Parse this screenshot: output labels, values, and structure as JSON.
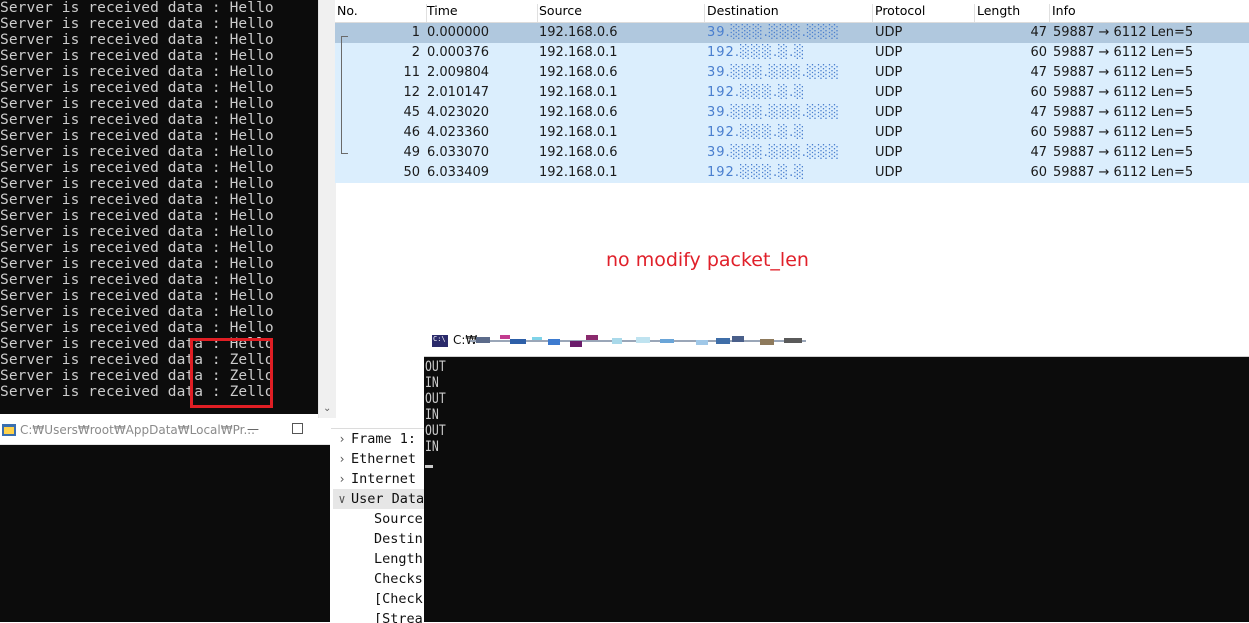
{
  "console_top": {
    "lines": [
      {
        "prefix": "Server is received data : ",
        "payload": "Hello"
      },
      {
        "prefix": "Server is received data : ",
        "payload": "Hello"
      },
      {
        "prefix": "Server is received data : ",
        "payload": "Hello"
      },
      {
        "prefix": "Server is received data : ",
        "payload": "Hello"
      },
      {
        "prefix": "Server is received data : ",
        "payload": "Hello"
      },
      {
        "prefix": "Server is received data : ",
        "payload": "Hello"
      },
      {
        "prefix": "Server is received data : ",
        "payload": "Hello"
      },
      {
        "prefix": "Server is received data : ",
        "payload": "Hello"
      },
      {
        "prefix": "Server is received data : ",
        "payload": "Hello"
      },
      {
        "prefix": "Server is received data : ",
        "payload": "Hello"
      },
      {
        "prefix": "Server is received data : ",
        "payload": "Hello"
      },
      {
        "prefix": "Server is received data : ",
        "payload": "Hello"
      },
      {
        "prefix": "Server is received data : ",
        "payload": "Hello"
      },
      {
        "prefix": "Server is received data : ",
        "payload": "Hello"
      },
      {
        "prefix": "Server is received data : ",
        "payload": "Hello"
      },
      {
        "prefix": "Server is received data : ",
        "payload": "Hello"
      },
      {
        "prefix": "Server is received data : ",
        "payload": "Hello"
      },
      {
        "prefix": "Server is received data : ",
        "payload": "Hello"
      },
      {
        "prefix": "Server is received data : ",
        "payload": "Hello"
      },
      {
        "prefix": "Server is received data : ",
        "payload": "Hello"
      },
      {
        "prefix": "Server is received data : ",
        "payload": "Hello"
      },
      {
        "prefix": "Server is received data : ",
        "payload": "Hello"
      },
      {
        "prefix": "Server is received data : ",
        "payload": "Zello"
      },
      {
        "prefix": "Server is received data : ",
        "payload": "Zello"
      },
      {
        "prefix": "Server is received data : ",
        "payload": "Zello"
      }
    ],
    "highlight_color": "#e01e24"
  },
  "console_second": {
    "title": "C:₩Users₩root₩AppData₩Local₩Pr...",
    "minimize_icon": "minimize-icon",
    "maximize_icon": "maximize-icon"
  },
  "packet_list": {
    "columns": [
      "No.",
      "Time",
      "Source",
      "Destination",
      "Protocol",
      "Length",
      "Info"
    ],
    "rows": [
      {
        "no": "1",
        "time": "0.000000",
        "source": "192.168.0.6",
        "destination": "39.░░░.░░░.░░░",
        "protocol": "UDP",
        "length": "47",
        "info": "59887 → 6112 Len=5",
        "selected": true
      },
      {
        "no": "2",
        "time": "0.000376",
        "source": "192.168.0.1",
        "destination": "192.░░░.░.░",
        "protocol": "UDP",
        "length": "60",
        "info": "59887 → 6112 Len=5",
        "selected": false
      },
      {
        "no": "11",
        "time": "2.009804",
        "source": "192.168.0.6",
        "destination": "39.░░░.░░░.░░░",
        "protocol": "UDP",
        "length": "47",
        "info": "59887 → 6112 Len=5",
        "selected": false
      },
      {
        "no": "12",
        "time": "2.010147",
        "source": "192.168.0.1",
        "destination": "192.░░░.░.░",
        "protocol": "UDP",
        "length": "60",
        "info": "59887 → 6112 Len=5",
        "selected": false
      },
      {
        "no": "45",
        "time": "4.023020",
        "source": "192.168.0.6",
        "destination": "39.░░░.░░░.░░░",
        "protocol": "UDP",
        "length": "47",
        "info": "59887 → 6112 Len=5",
        "selected": false
      },
      {
        "no": "46",
        "time": "4.023360",
        "source": "192.168.0.1",
        "destination": "192.░░░.░.░",
        "protocol": "UDP",
        "length": "60",
        "info": "59887 → 6112 Len=5",
        "selected": false
      },
      {
        "no": "49",
        "time": "6.033070",
        "source": "192.168.0.6",
        "destination": "39.░░░.░░░.░░░",
        "protocol": "UDP",
        "length": "47",
        "info": "59887 → 6112 Len=5",
        "selected": false
      },
      {
        "no": "50",
        "time": "6.033409",
        "source": "192.168.0.1",
        "destination": "192.░░░.░.░",
        "protocol": "UDP",
        "length": "60",
        "info": "59887 → 6112 Len=5",
        "selected": false
      }
    ],
    "row_color": "#dbeefd",
    "selected_color": "#b0c8de"
  },
  "annotation": {
    "text": "no modify packet_len",
    "color": "#e0202a"
  },
  "packet_details": {
    "items": [
      {
        "label": "Frame 1:",
        "chevron": "›",
        "indent": 0,
        "selected": false
      },
      {
        "label": "Ethernet",
        "chevron": "›",
        "indent": 0,
        "selected": false
      },
      {
        "label": "Internet",
        "chevron": "›",
        "indent": 0,
        "selected": false
      },
      {
        "label": "User Data",
        "chevron": "∨",
        "indent": 0,
        "selected": true
      },
      {
        "label": "Source",
        "chevron": "",
        "indent": 1,
        "selected": false
      },
      {
        "label": "Destin",
        "chevron": "",
        "indent": 1,
        "selected": false
      },
      {
        "label": "Length",
        "chevron": "",
        "indent": 1,
        "selected": false
      },
      {
        "label": "Checks",
        "chevron": "",
        "indent": 1,
        "selected": false
      },
      {
        "label": "[Check",
        "chevron": "",
        "indent": 1,
        "selected": false
      },
      {
        "label": "[Strea",
        "chevron": "",
        "indent": 1,
        "selected": false
      }
    ]
  },
  "console_third": {
    "title": "C:₩",
    "lines": [
      "OUT",
      "IN",
      "OUT",
      "IN",
      "OUT",
      "IN"
    ]
  }
}
